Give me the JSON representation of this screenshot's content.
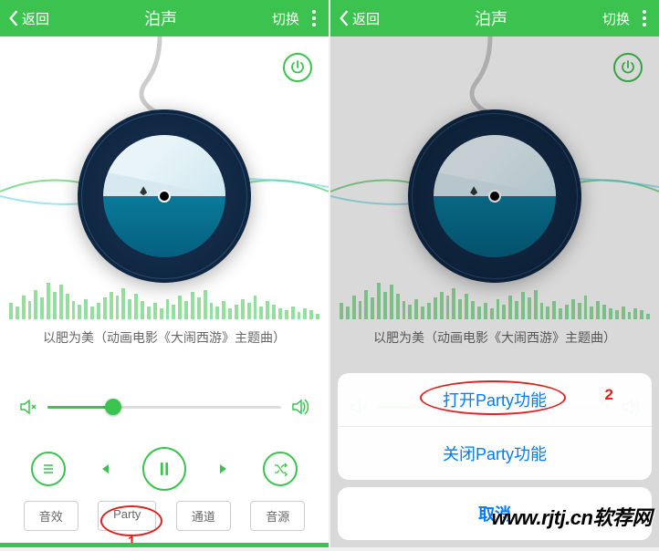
{
  "header": {
    "back": "返回",
    "title": "泊声",
    "switch": "切换"
  },
  "track": "以肥为美（动画电影《大闹西游》主题曲）",
  "volume_percent": 28,
  "eq_bars": [
    18,
    14,
    26,
    20,
    32,
    24,
    40,
    30,
    38,
    28,
    20,
    16,
    22,
    14,
    18,
    24,
    30,
    26,
    34,
    22,
    28,
    20,
    14,
    18,
    12,
    22,
    16,
    26,
    20,
    30,
    24,
    32,
    18,
    14,
    20,
    12,
    16,
    22,
    18,
    26,
    14,
    20,
    16,
    12,
    10,
    14,
    8,
    12,
    10,
    6
  ],
  "tabs": {
    "effect": "音效",
    "party": "Party",
    "channel": "通道",
    "source": "音源"
  },
  "sheet": {
    "open_party": "打开Party功能",
    "close_party": "关闭Party功能",
    "cancel": "取消"
  },
  "annotations": {
    "label1": "1",
    "label2": "2"
  },
  "watermark": "www.rjtj.cn软荐网"
}
